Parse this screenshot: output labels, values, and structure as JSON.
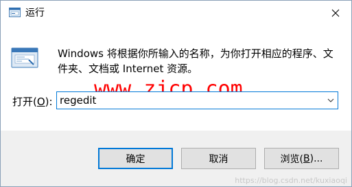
{
  "window": {
    "title": "运行",
    "close_icon": "close-icon",
    "title_icon": "run-app-icon"
  },
  "description": "Windows 将根据你所输入的名称，为你打开相应的程序、文件夹、文档或 Internet 资源。",
  "watermark_text": "www.zjcp.com",
  "open": {
    "label_prefix": "打开(",
    "label_accel": "O",
    "label_suffix": "):",
    "value": "regedit",
    "dropdown_icon": "chevron-down-icon"
  },
  "buttons": {
    "ok": "确定",
    "cancel": "取消",
    "browse_prefix": "浏览(",
    "browse_accel": "B",
    "browse_suffix": ")..."
  },
  "url_watermark": "https://blog.csdn.net/kuxiaoqi",
  "colors": {
    "accent": "#0078d7",
    "watermark": "#ff0000",
    "footer_bg": "#f0f0f0"
  }
}
